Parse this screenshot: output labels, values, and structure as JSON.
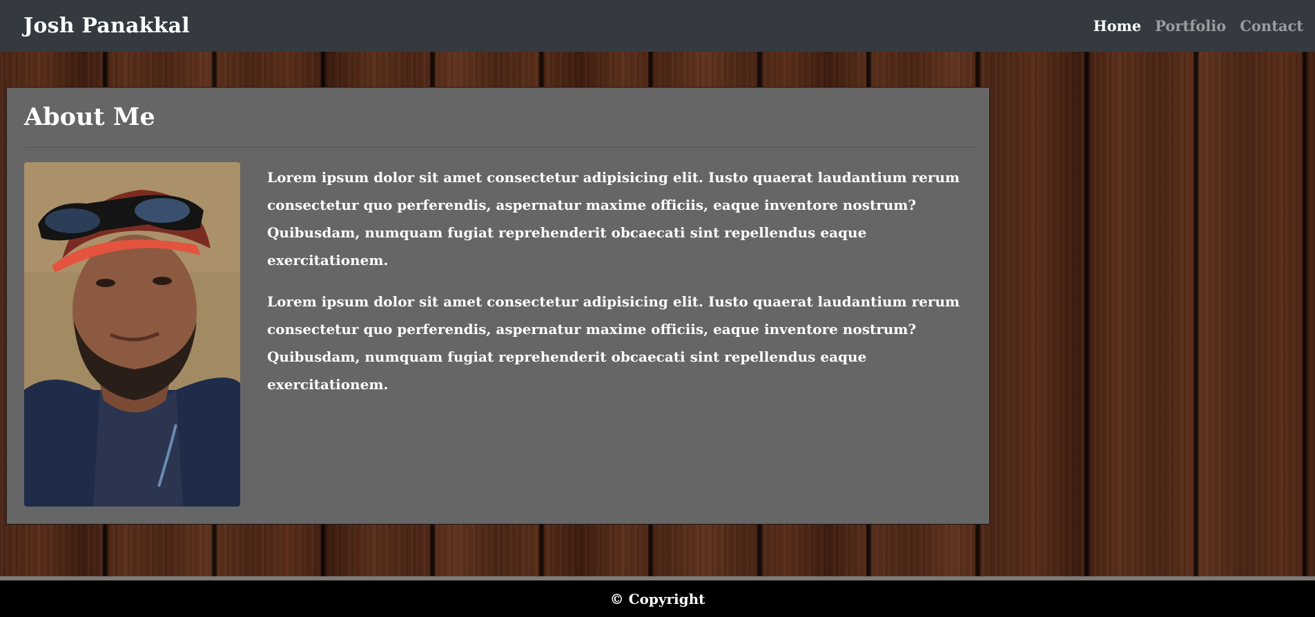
{
  "header": {
    "brand": "Josh Panakkal",
    "nav": [
      {
        "label": "Home",
        "active": true
      },
      {
        "label": "Portfolio",
        "active": false
      },
      {
        "label": "Contact",
        "active": false
      }
    ]
  },
  "about": {
    "title": "About Me",
    "paragraphs": [
      "Lorem ipsum dolor sit amet consectetur adipisicing elit. Iusto quaerat laudantium rerum consectetur quo perferendis, aspernatur maxime officiis, eaque inventore nostrum? Quibusdam, numquam fugiat reprehenderit obcaecati sint repellendus eaque exercitationem.",
      "Lorem ipsum dolor sit amet consectetur adipisicing elit. Iusto quaerat laudantium rerum consectetur quo perferendis, aspernatur maxime officiis, eaque inventore nostrum? Quibusdam, numquam fugiat reprehenderit obcaecati sint repellendus eaque exercitationem."
    ]
  },
  "footer": {
    "text": "© Copyright"
  },
  "colors": {
    "navbar": "#343a40",
    "card": "#666666",
    "footer": "#000000",
    "nav_active": "#ffffff",
    "nav_inactive": "rgba(255,255,255,0.5)"
  }
}
